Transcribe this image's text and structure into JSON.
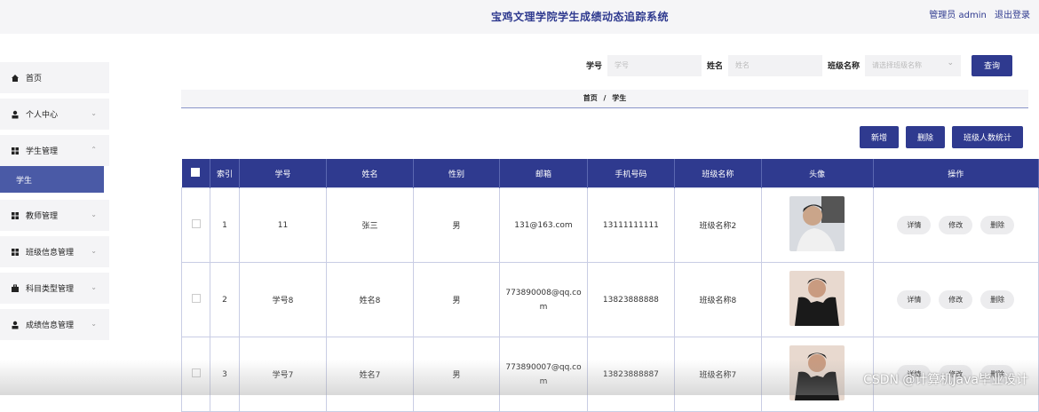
{
  "header": {
    "title": "宝鸡文理学院学生成绩动态追踪系统",
    "user_label": "管理员 admin",
    "logout": "退出登录"
  },
  "sidebar": {
    "items": [
      {
        "label": "首页",
        "icon": "home-icon",
        "expand": false
      },
      {
        "label": "个人中心",
        "icon": "user-icon",
        "expand": true
      },
      {
        "label": "学生管理",
        "icon": "grid-icon",
        "expand": true,
        "open": true,
        "sub": "学生"
      },
      {
        "label": "教师管理",
        "icon": "grid-icon",
        "expand": true
      },
      {
        "label": "班级信息管理",
        "icon": "grid-icon",
        "expand": true
      },
      {
        "label": "科目类型管理",
        "icon": "briefcase-icon",
        "expand": true
      },
      {
        "label": "成绩信息管理",
        "icon": "user-icon",
        "expand": true
      }
    ]
  },
  "search": {
    "no_label": "学号",
    "no_placeholder": "学号",
    "name_label": "姓名",
    "name_placeholder": "姓名",
    "class_label": "班级名称",
    "class_placeholder": "请选择班级名称",
    "query_button": "查询"
  },
  "breadcrumb": {
    "home": "首页",
    "sep": "/",
    "current": "学生"
  },
  "actions": {
    "add": "新增",
    "delete": "删除",
    "stats": "班级人数统计"
  },
  "table": {
    "headers": [
      "索引",
      "学号",
      "姓名",
      "性别",
      "邮箱",
      "手机号码",
      "班级名称",
      "头像",
      "操作"
    ],
    "rows": [
      {
        "index": "1",
        "no": "11",
        "name": "张三",
        "gender": "男",
        "email": "131@163.com",
        "phone": "13111111111",
        "class": "班级名称2"
      },
      {
        "index": "2",
        "no": "学号8",
        "name": "姓名8",
        "gender": "男",
        "email": "773890008@qq.com",
        "phone": "13823888888",
        "class": "班级名称8"
      },
      {
        "index": "3",
        "no": "学号7",
        "name": "姓名7",
        "gender": "男",
        "email": "773890007@qq.com",
        "phone": "13823888887",
        "class": "班级名称7"
      }
    ],
    "ops": {
      "detail": "详情",
      "edit": "修改",
      "delete": "删除"
    }
  },
  "watermark": "CSDN @计算机Java毕业设计"
}
